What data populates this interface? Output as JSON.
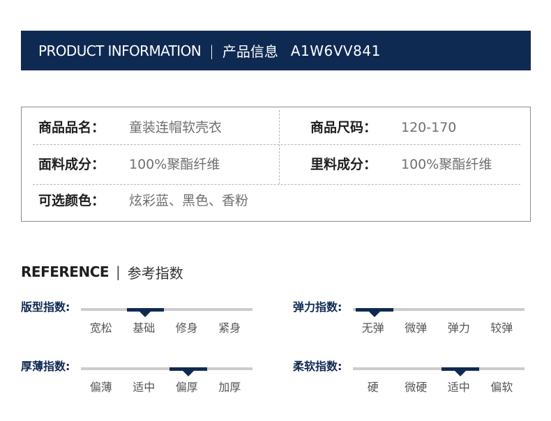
{
  "header": {
    "title_en": "PRODUCT INFORMATION",
    "separator": "|",
    "title_cn": "产品信息",
    "sku": "A1W6VV841"
  },
  "info": {
    "name_key": "商品品名：",
    "name_value": "童装连帽软壳衣",
    "size_key": "商品尺码：",
    "size_value": "120-170",
    "outer_key": "面料成分：",
    "outer_value": "100%聚酯纤维",
    "lining_key": "里料成分：",
    "lining_value": "100%聚酯纤维",
    "color_key": "可选颜色：",
    "color_value": "炫彩蓝、黑色、香粉"
  },
  "reference": {
    "title_en": "REFERENCE",
    "separator": "|",
    "title_cn": "参考指数"
  },
  "scales": {
    "fit": {
      "label": "版型指数:",
      "options": [
        "宽松",
        "基础",
        "修身",
        "紧身"
      ],
      "selected_index": 1
    },
    "elastic": {
      "label": "弹力指数:",
      "options": [
        "无弹",
        "微弹",
        "弹力",
        "较弹"
      ],
      "selected_index": 0
    },
    "thickness": {
      "label": "厚薄指数:",
      "options": [
        "偏薄",
        "适中",
        "偏厚",
        "加厚"
      ],
      "selected_index": 2
    },
    "softness": {
      "label": "柔软指数:",
      "options": [
        "硬",
        "微硬",
        "适中",
        "偏软"
      ],
      "selected_index": 2
    }
  },
  "colors": {
    "brand_navy": "#0f2a52",
    "track_gray": "#cccccc"
  }
}
